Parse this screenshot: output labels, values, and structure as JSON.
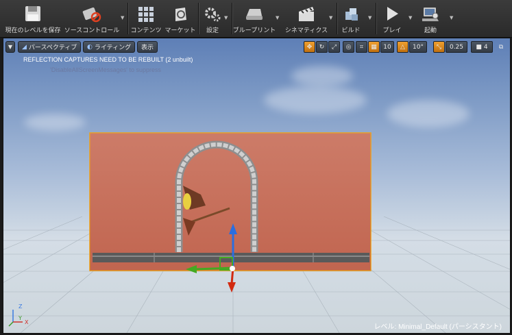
{
  "toolbar": {
    "save": "現在のレベルを保存",
    "source_control": "ソースコントロール",
    "content": "コンテンツ",
    "market": "マーケット",
    "settings": "設定",
    "blueprints": "ブループリント",
    "cinematics": "シネマティクス",
    "build": "ビルド",
    "play": "プレイ",
    "launch": "起動"
  },
  "viewport": {
    "perspective": "パースペクティブ",
    "lighting": "ライティング",
    "show": "表示",
    "grid_snap": "10",
    "rotation_snap": "10°",
    "scale_snap": "0.25",
    "camera_speed": "4",
    "message_warning": "REFLECTION CAPTURES NEED TO BE REBUILT (2 unbuilt)",
    "message_hint": "'DisableAllScreenMessages' to suppress",
    "level_label": "レベル:",
    "level_name": "Minimal_Default (パーシスタント)"
  },
  "axis": {
    "z": "Z",
    "y": "Y",
    "x": "X"
  }
}
